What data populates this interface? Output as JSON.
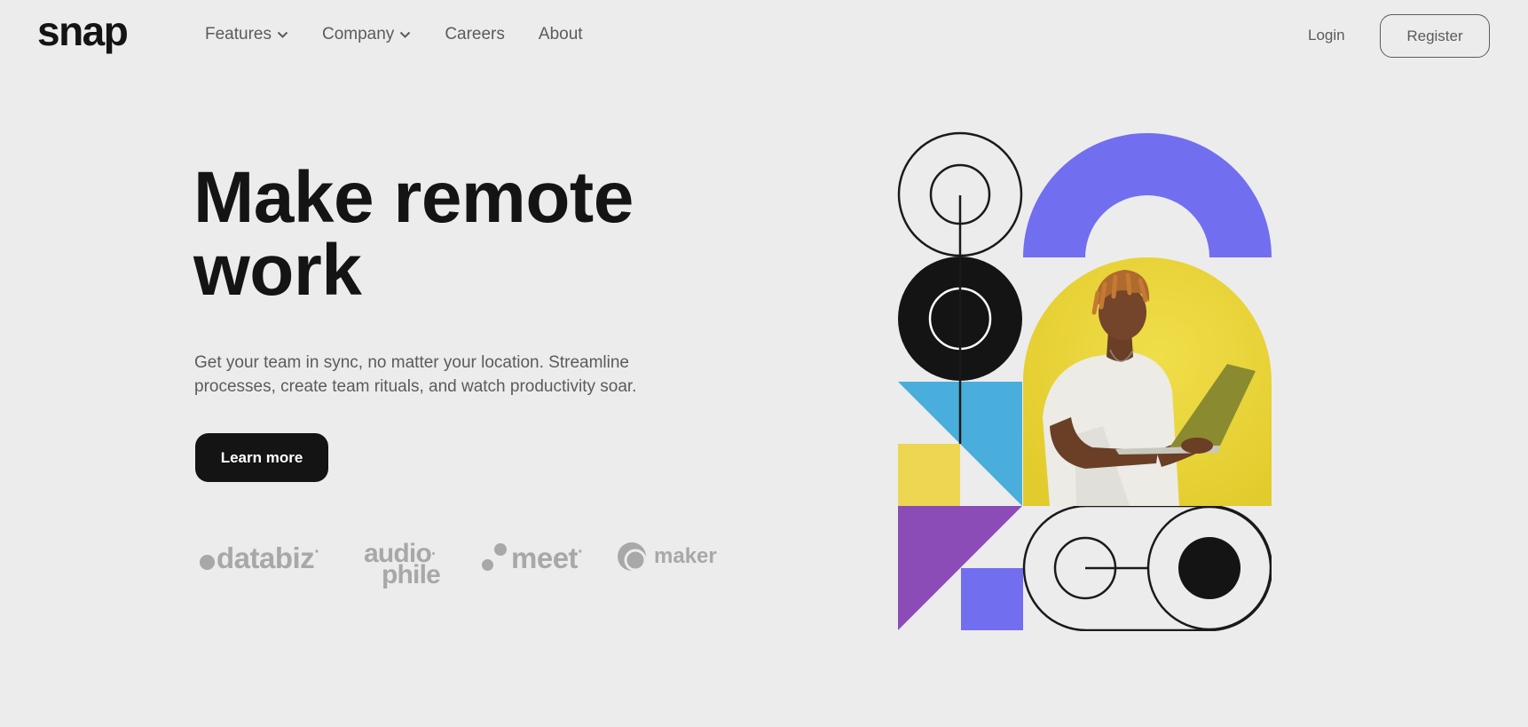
{
  "header": {
    "logo": "snap",
    "nav": [
      {
        "label": "Features",
        "has_dropdown": true
      },
      {
        "label": "Company",
        "has_dropdown": true
      },
      {
        "label": "Careers",
        "has_dropdown": false
      },
      {
        "label": "About",
        "has_dropdown": false
      }
    ],
    "login_label": "Login",
    "register_label": "Register"
  },
  "hero": {
    "title_line1": "Make remote",
    "title_line2": "work",
    "description_line1": "Get your team in sync, no matter your location. Streamline",
    "description_line2": "processes, create team rituals, and watch productivity soar.",
    "cta_label": "Learn more"
  },
  "clients": {
    "databiz": "databiz",
    "databiz_mark": "·",
    "audiophile_line1": "audio",
    "audiophile_line2": "phile",
    "audiophile_mark": "·",
    "meet": "meet",
    "meet_mark": "·",
    "maker": "maker"
  },
  "colors": {
    "background": "#ececec",
    "text_dark": "#141414",
    "text_gray": "#5b5b5b",
    "logo_gray": "#a8a8a8",
    "purple": "#726ef0",
    "yellow": "#e8d43c",
    "blue": "#4aaedc",
    "violet": "#8c4cb8"
  },
  "icons": {
    "dropdown": "chevron-down-icon",
    "hero_image": "person-with-laptop-photo"
  }
}
